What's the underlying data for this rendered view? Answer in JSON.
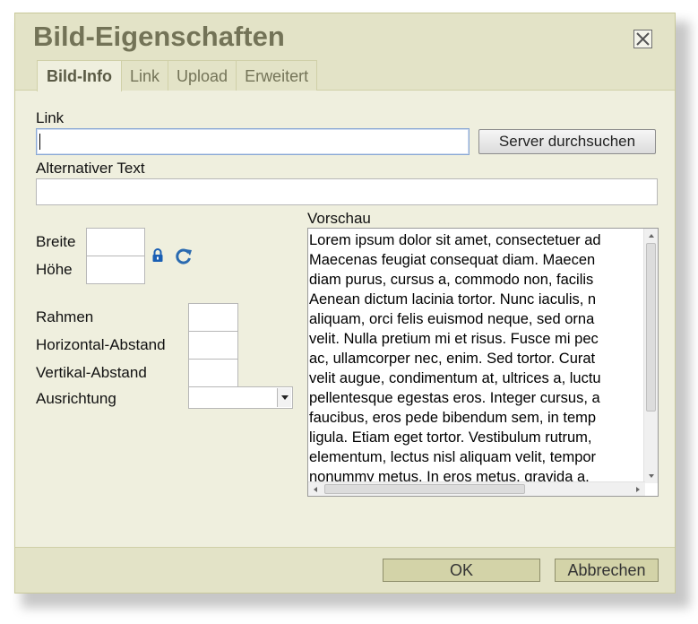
{
  "dialog": {
    "title": "Bild-Eigenschaften",
    "tabs": [
      {
        "label": "Bild-Info"
      },
      {
        "label": "Link"
      },
      {
        "label": "Upload"
      },
      {
        "label": "Erweitert"
      }
    ]
  },
  "form": {
    "link_label": "Link",
    "link_value": "",
    "browse_button": "Server durchsuchen",
    "alt_label": "Alternativer Text",
    "alt_value": "",
    "width_label": "Breite",
    "height_label": "Höhe",
    "border_label": "Rahmen",
    "hspace_label": "Horizontal-Abstand",
    "vspace_label": "Vertikal-Abstand",
    "align_label": "Ausrichtung",
    "align_value": "",
    "lock_icon": "lock-icon",
    "reset_icon": "reset-size-icon"
  },
  "preview": {
    "label": "Vorschau",
    "lines": [
      "Lorem ipsum dolor sit amet, consectetuer ad",
      "Maecenas feugiat consequat diam. Maecen",
      "diam purus, cursus a, commodo non, facilis",
      "Aenean dictum lacinia tortor. Nunc iaculis, n",
      "aliquam, orci felis euismod neque, sed orna",
      "velit. Nulla pretium mi et risus. Fusce mi pec",
      "ac, ullamcorper nec, enim. Sed tortor. Curat",
      "velit augue, condimentum at, ultrices a, luctu",
      "pellentesque egestas eros. Integer cursus, a",
      "faucibus, eros pede bibendum sem, in temp",
      "ligula. Etiam eget tortor. Vestibulum rutrum,",
      "elementum, lectus nisl aliquam velit, tempor",
      "nonummy metus. In eros metus, gravida a,"
    ]
  },
  "footer": {
    "ok_button": "OK",
    "cancel_button": "Abbrechen"
  }
}
